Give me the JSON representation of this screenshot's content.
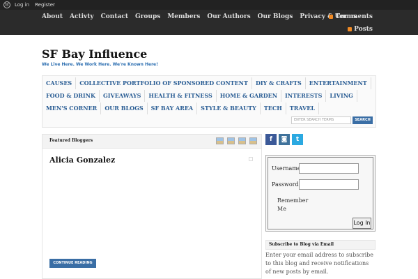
{
  "adminbar": {
    "login": "Log in",
    "register": "Register"
  },
  "topnav": {
    "items": [
      "About",
      "Activty",
      "Contact",
      "Groups",
      "Members",
      "Our Authors",
      "Our Blogs",
      "Privacy & Terms"
    ],
    "comments": "Comments",
    "posts": "Posts"
  },
  "header": {
    "title": "SF Bay Influence",
    "tagline": "We Live Here. We Work Here. We're Known Here!"
  },
  "categories": {
    "row1": [
      "CAUSES",
      "COLLECTIVE PORTFOLIO OF SPONSORED CONTENT",
      "DIY & CRAFTS",
      "ENTERTAINMENT"
    ],
    "row2": [
      "FOOD & DRINK",
      "GIVEAWAYS",
      "HEALTH & FITNESS",
      "HOME & GARDEN",
      "INTERESTS",
      "LIVING"
    ],
    "row3": [
      "MEN'S CORNER",
      "OUR BLOGS",
      "SF BAY AREA",
      "STYLE & BEAUTY",
      "TECH",
      "TRAVEL"
    ]
  },
  "search": {
    "placeholder": "ENTER SEARCH TERMS",
    "button": "SEARCH"
  },
  "featured": {
    "label": "Featured Bloggers",
    "name": "Alicia Gonzalez",
    "continue": "CONTINUE READING"
  },
  "social": {
    "facebook": "f",
    "instagram": "◙",
    "twitter": "t"
  },
  "login": {
    "username": "Username:",
    "password": "Password:",
    "remember": "Remember Me",
    "button": "Log In"
  },
  "subscribe": {
    "title": "Subscribe to Blog via Email",
    "text": "Enter your email address to subscribe to this blog and receive notifications of new posts by email."
  }
}
